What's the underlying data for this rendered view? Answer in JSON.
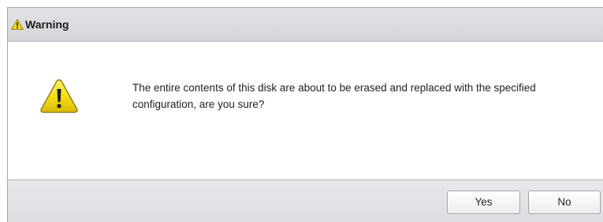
{
  "dialog": {
    "title": "Warning",
    "title_icon": "warning-icon",
    "message_icon": "warning-icon",
    "message": "The entire contents of this disk are about to be erased and replaced with the specified configuration, are you sure?",
    "buttons": {
      "yes_label": "Yes",
      "no_label": "No"
    }
  },
  "colors": {
    "warning_fill": "#f2dc12",
    "warning_outline": "#8a7a12",
    "titlebar": "#d9dbde",
    "footer": "#e2e3e6"
  }
}
